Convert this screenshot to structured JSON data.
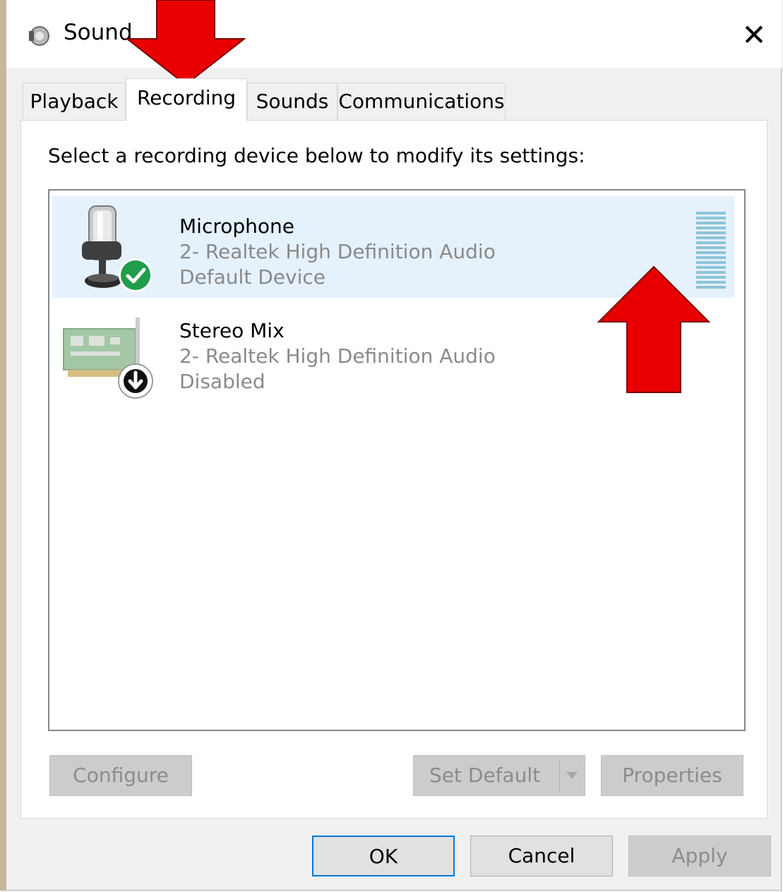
{
  "window": {
    "title": "Sound",
    "close_glyph": "✕"
  },
  "tabs": [
    {
      "label": "Playback"
    },
    {
      "label": "Recording",
      "active": true
    },
    {
      "label": "Sounds"
    },
    {
      "label": "Communications"
    }
  ],
  "recording": {
    "instruction": "Select a recording device below to modify its settings:",
    "devices": [
      {
        "name": "Microphone",
        "driver": "2- Realtek High Definition Audio",
        "status": "Default Device",
        "icon": "microphone-icon",
        "badge": "green-check-badge-icon",
        "selected": true
      },
      {
        "name": "Stereo Mix",
        "driver": "2- Realtek High Definition Audio",
        "status": "Disabled",
        "icon": "sound-card-icon",
        "badge": "down-arrow-badge-icon",
        "selected": false
      }
    ]
  },
  "buttons": {
    "configure": "Configure",
    "set_default": "Set Default",
    "properties": "Properties",
    "ok": "OK",
    "cancel": "Cancel",
    "apply": "Apply"
  },
  "colors": {
    "selection": "#e5f1fb",
    "annotation_arrow": "#e80000",
    "default_badge": "#16a34a",
    "level_meter": "#8ec5d9"
  }
}
